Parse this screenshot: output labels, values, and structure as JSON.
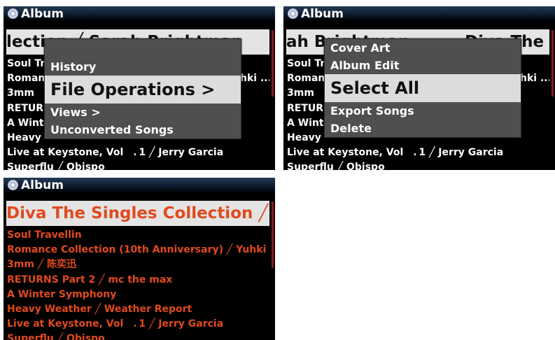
{
  "panel_a": {
    "title": "Album",
    "selected_text": "lection ╱ Sarah Brightman",
    "rows": [
      "Soul Tr",
      "Roman",
      "3mm",
      "RETUR",
      "A Wint",
      "Heavy",
      "Live at Keystone, Vol　. 1 ╱ Jerry Garcia",
      "Superflu ╱ Obispo"
    ],
    "row_tail_roman": "hki ...",
    "menu": [
      "History",
      "File Operations >",
      "Views >",
      "Unconverted Songs"
    ]
  },
  "panel_b": {
    "title": "Album",
    "selected_text": "ah Brightman",
    "selected_text_right": "Diva The Si",
    "rows": [
      "Soul Tr",
      "Roman",
      "3mm",
      "RETUR",
      "A Wint",
      "Heavy",
      "Live at Keystone, Vol　. 1 ╱ Jerry Garcia",
      "Superflu ╱ Obispo"
    ],
    "row_tail_roman": "hki ...",
    "menu": [
      "Cover Art",
      "Album Edit",
      "Select All",
      "Export Songs",
      "Delete"
    ]
  },
  "panel_c": {
    "title": "Album",
    "selected_text": "Diva The Singles Collection ╱ Sa",
    "rows": [
      "Soul Travellin",
      "Romance Collection (10th Anniversary) ╱ Yuhki ...",
      "3mm ╱ 陈奕迅",
      "RETURNS Part 2 ╱ mc the max",
      "A Winter Symphony",
      "Heavy Weather ╱ Weather Report",
      "Live at Keystone, Vol　. 1 ╱ Jerry Garcia",
      "Superflu ╱ Obispo"
    ]
  },
  "colors": {
    "titlebar": "#0d1a2c",
    "selected": "#e4e4e4",
    "red_text": "#e04a1e",
    "menu_bg": "#4f4f4f"
  }
}
